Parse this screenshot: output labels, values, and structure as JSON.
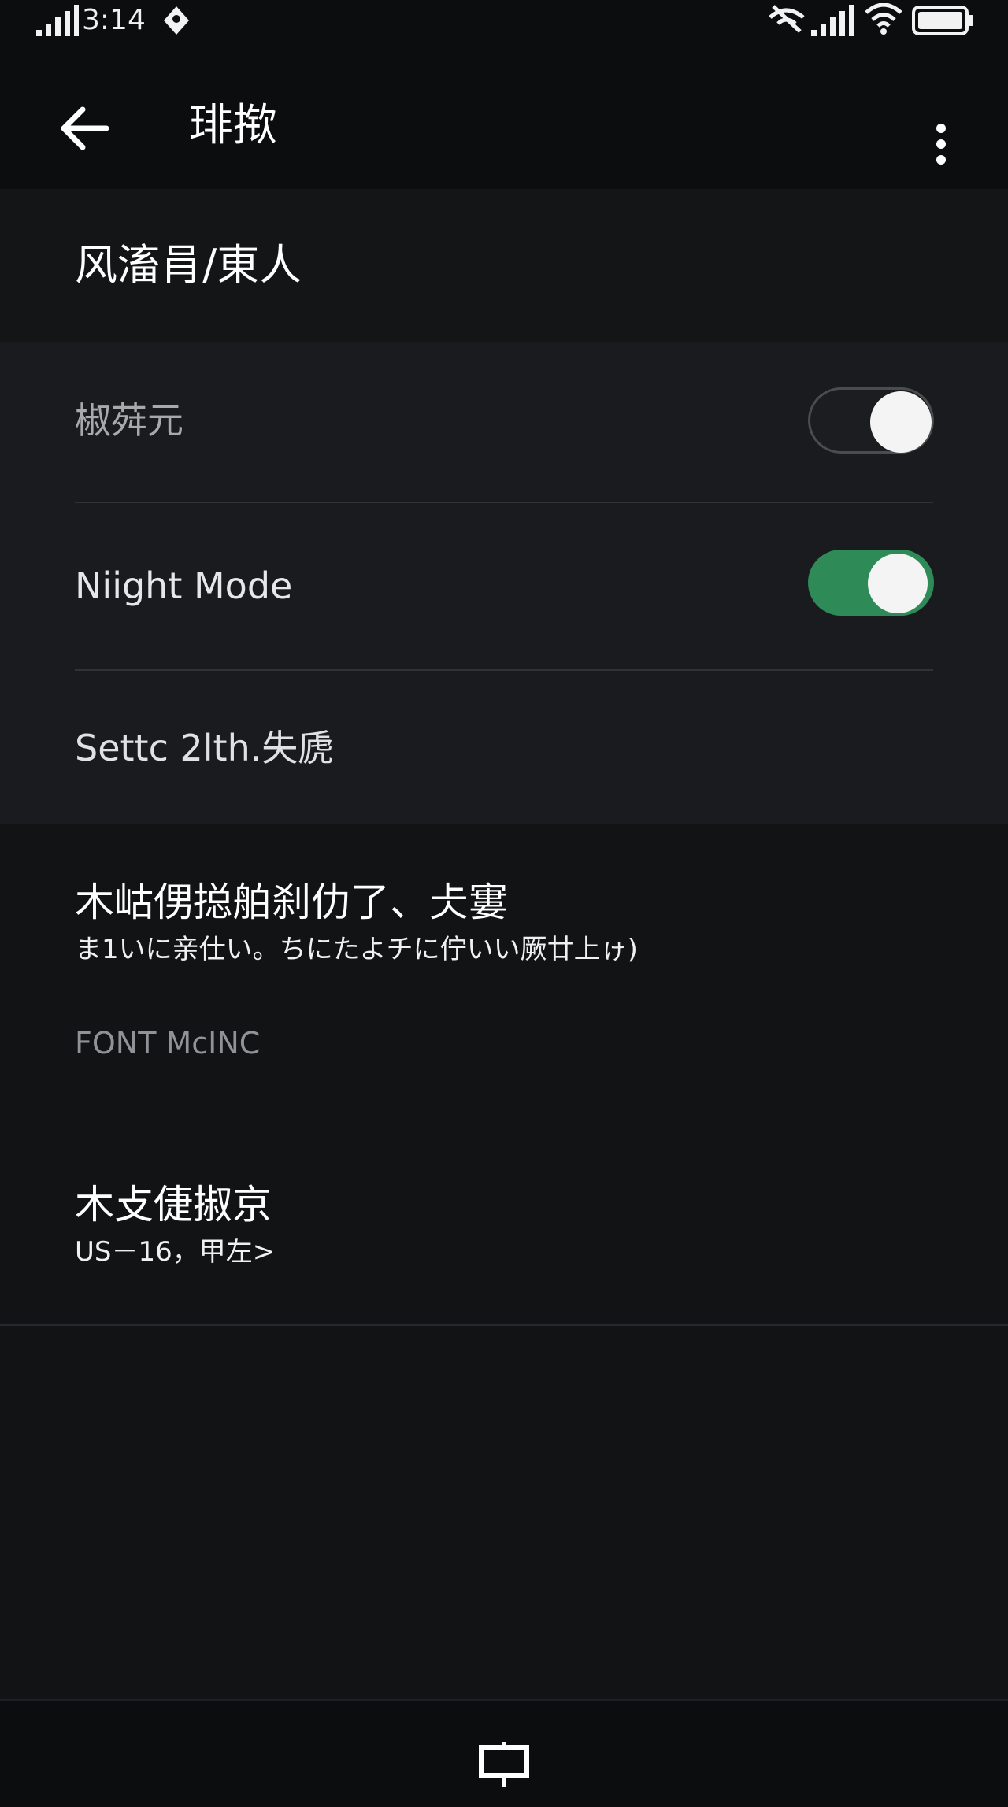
{
  "status_bar": {
    "time": "3:14",
    "icons": [
      "signal-icon",
      "alert-icon",
      "mute-icon",
      "signal-icon",
      "wifi-icon",
      "battery-icon"
    ]
  },
  "app_bar": {
    "title": "琲揿",
    "back_icon": "arrow-left-icon",
    "menu_icon": "more-vertical-icon"
  },
  "section": {
    "header": "风滀肙/東人"
  },
  "settings": {
    "row1": {
      "label": "椒荈元",
      "toggle_on": false
    },
    "row2": {
      "label": "Niight Mode",
      "toggle_on": true
    },
    "row3": {
      "label": "Settc 2lth.失虒"
    }
  },
  "font_section": {
    "item1": {
      "title": "木岵侽搃舶刹仂了、仧寠",
      "subtitle": "ま1いに亲仕い。ちにたよチに佇いい厥廿上ゖ)"
    },
    "caption": "FONT McINC",
    "item2": {
      "title": "木攴倢掓京",
      "subtitle": "US－16，甲左>"
    }
  },
  "bottom_nav": {
    "icon": "home-frame-icon"
  },
  "colors": {
    "background": "#121315",
    "card": "#1a1b1e",
    "toggle_on": "#2e8b57",
    "muted_text": "#8f9296"
  }
}
